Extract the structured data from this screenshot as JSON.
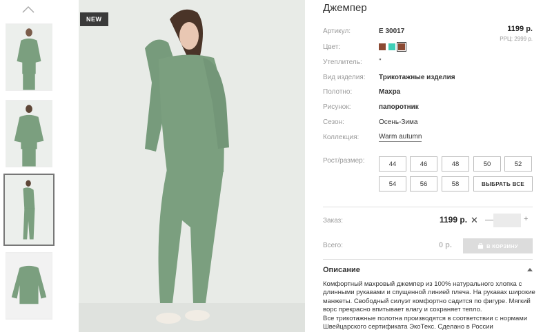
{
  "thumbnails": {
    "scroll_up_icon": "chevron-up-icon"
  },
  "main_image": {
    "badge": "NEW"
  },
  "product": {
    "title": "Джемпер",
    "price": "1199 р.",
    "rrp": "РРЦ: 2999 р.",
    "colors": [
      "#8b4a33",
      "#3fcfb8",
      "#8b4a33"
    ],
    "attributes": [
      {
        "label": "Артикул:",
        "value": "E 30017",
        "bold": true
      },
      {
        "label": "Цвет:",
        "value": ""
      },
      {
        "label": "Утеплитель:",
        "value": "\""
      },
      {
        "label": "Вид изделия:",
        "value": "Трикотажные изделия",
        "bold": true
      },
      {
        "label": "Полотно:",
        "value": "Махра",
        "bold": true
      },
      {
        "label": "Рисунок:",
        "value": "папоротник",
        "bold": true
      },
      {
        "label": "Сезон:",
        "value": "Осень-Зима"
      },
      {
        "label": "Коллекция:",
        "value": "Warm autumn"
      }
    ],
    "size_label": "Рост/размер:",
    "sizes": [
      "44",
      "46",
      "48",
      "50",
      "52",
      "54",
      "56",
      "58"
    ],
    "select_all": "ВЫБРАТЬ ВСЕ"
  },
  "order": {
    "label": "Заказ:",
    "price": "1199 р.",
    "times": "✕",
    "minus": "—",
    "plus": "+",
    "qty": ""
  },
  "total": {
    "label": "Всего:",
    "value": "0 р.",
    "cart_button": "В КОРЗИНУ"
  },
  "description": {
    "title": "Описание",
    "lines": [
      "Комфортный махровый джемпер из 100% натурального хлопка с",
      "длинными рукавами и спущенной линией плеча. На рукавах широкие",
      "манжеты. Свободный силуэт комфортно садится по фигуре. Мягкий",
      "ворс прекрасно впитывает влагу и сохраняет тепло.",
      "Все трикотажные полотна производятся в соответствии с нормами",
      "Швейцарского сертификата ЭкоТекс. Сделано в России"
    ]
  }
}
